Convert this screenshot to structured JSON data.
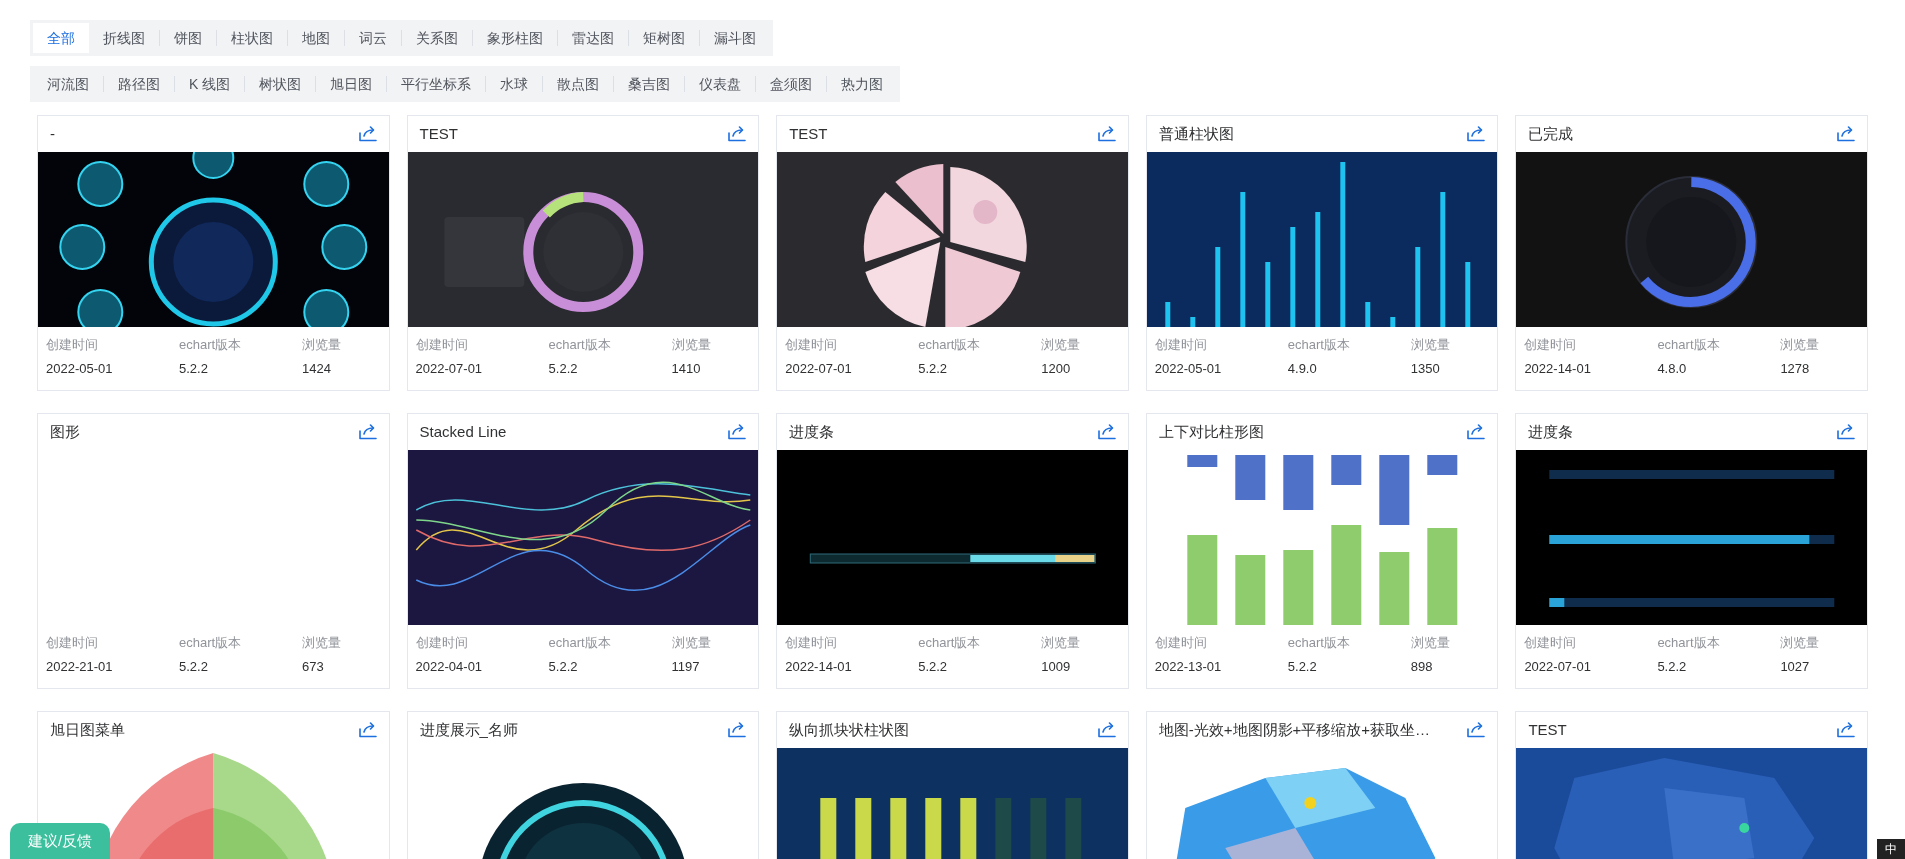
{
  "tab_rows": [
    [
      {
        "label": "全部",
        "selected": true
      },
      {
        "label": "折线图",
        "selected": false
      },
      {
        "label": "饼图",
        "selected": false
      },
      {
        "label": "柱状图",
        "selected": false
      },
      {
        "label": "地图",
        "selected": false
      },
      {
        "label": "词云",
        "selected": false
      },
      {
        "label": "关系图",
        "selected": false
      },
      {
        "label": "象形柱图",
        "selected": false
      },
      {
        "label": "雷达图",
        "selected": false
      },
      {
        "label": "矩树图",
        "selected": false
      },
      {
        "label": "漏斗图",
        "selected": false
      }
    ],
    [
      {
        "label": "河流图",
        "selected": false
      },
      {
        "label": "路径图",
        "selected": false
      },
      {
        "label": "K 线图",
        "selected": false
      },
      {
        "label": "树状图",
        "selected": false
      },
      {
        "label": "旭日图",
        "selected": false
      },
      {
        "label": "平行坐标系",
        "selected": false
      },
      {
        "label": "水球",
        "selected": false
      },
      {
        "label": "散点图",
        "selected": false
      },
      {
        "label": "桑吉图",
        "selected": false
      },
      {
        "label": "仪表盘",
        "selected": false
      },
      {
        "label": "盒须图",
        "selected": false
      },
      {
        "label": "热力图",
        "selected": false
      }
    ]
  ],
  "cards": [
    {
      "title": "-",
      "meta": {
        "labels": [
          "创建时间",
          "echart版本",
          "浏览量"
        ],
        "values": [
          "2022-05-01",
          "5.2.2",
          "1424"
        ]
      }
    },
    {
      "title": "TEST",
      "meta": {
        "labels": [
          "创建时间",
          "echart版本",
          "浏览量"
        ],
        "values": [
          "2022-07-01",
          "5.2.2",
          "1410"
        ]
      }
    },
    {
      "title": "TEST",
      "meta": {
        "labels": [
          "创建时间",
          "echart版本",
          "浏览量"
        ],
        "values": [
          "2022-07-01",
          "5.2.2",
          "1200"
        ]
      }
    },
    {
      "title": "普通柱状图",
      "meta": {
        "labels": [
          "创建时间",
          "echart版本",
          "浏览量"
        ],
        "values": [
          "2022-05-01",
          "4.9.0",
          "1350"
        ]
      }
    },
    {
      "title": "已完成",
      "meta": {
        "labels": [
          "创建时间",
          "echart版本",
          "浏览量"
        ],
        "values": [
          "2022-14-01",
          "4.8.0",
          "1278"
        ]
      }
    },
    {
      "title": "图形",
      "meta": {
        "labels": [
          "创建时间",
          "echart版本",
          "浏览量"
        ],
        "values": [
          "2022-21-01",
          "5.2.2",
          "673"
        ]
      }
    },
    {
      "title": "Stacked Line",
      "meta": {
        "labels": [
          "创建时间",
          "echart版本",
          "浏览量"
        ],
        "values": [
          "2022-04-01",
          "5.2.2",
          "1197"
        ]
      }
    },
    {
      "title": "进度条",
      "meta": {
        "labels": [
          "创建时间",
          "echart版本",
          "浏览量"
        ],
        "values": [
          "2022-14-01",
          "5.2.2",
          "1009"
        ]
      }
    },
    {
      "title": "上下对比柱形图",
      "meta": {
        "labels": [
          "创建时间",
          "echart版本",
          "浏览量"
        ],
        "values": [
          "2022-13-01",
          "5.2.2",
          "898"
        ]
      }
    },
    {
      "title": "进度条",
      "meta": {
        "labels": [
          "创建时间",
          "echart版本",
          "浏览量"
        ],
        "values": [
          "2022-07-01",
          "5.2.2",
          "1027"
        ]
      }
    },
    {
      "title": "旭日图菜单"
    },
    {
      "title": "进度展示_名师"
    },
    {
      "title": "纵向抓块状柱状图"
    },
    {
      "title": "地图-光效+地图阴影+平移缩放+获取坐…"
    },
    {
      "title": "TEST"
    }
  ],
  "feedback_button": "建议/反馈",
  "ime_bar": {
    "label": "中"
  }
}
